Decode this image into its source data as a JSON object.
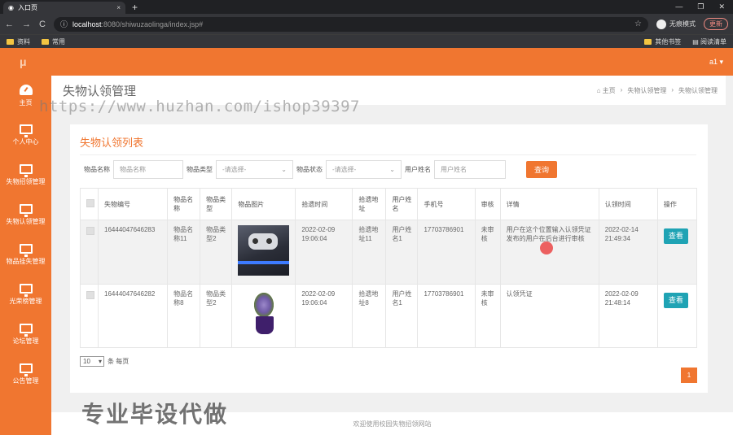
{
  "browser": {
    "tab_title": "入口页",
    "tab_close": "×",
    "new_tab": "+",
    "window_controls": [
      "—",
      "❐",
      "✕"
    ],
    "nav": [
      "←",
      "→",
      "C"
    ],
    "url_host": "localhost",
    "url_path": ":8080/shiwuzaolinga/index.jsp#",
    "star": "☆",
    "incognito": "无痕模式",
    "update_label": "更新",
    "bookmarks": [
      "资料",
      "常用"
    ],
    "bookmarks_right": [
      "其他书签",
      "阅读清单"
    ]
  },
  "header": {
    "logo": "μ",
    "user": "a1 ▾"
  },
  "sidebar": {
    "items": [
      {
        "label": "主页",
        "icon": "gauge-icon"
      },
      {
        "label": "个人中心",
        "icon": "monitor-icon"
      },
      {
        "label": "失物招领管理",
        "icon": "monitor-icon"
      },
      {
        "label": "失物认领管理",
        "icon": "monitor-icon"
      },
      {
        "label": "物品挂失管理",
        "icon": "monitor-icon"
      },
      {
        "label": "光荣榜管理",
        "icon": "monitor-icon"
      },
      {
        "label": "论坛管理",
        "icon": "monitor-icon"
      },
      {
        "label": "公告管理",
        "icon": "monitor-icon"
      }
    ]
  },
  "page": {
    "title": "失物认领管理",
    "breadcrumb": [
      "⌂ 主页",
      "›",
      "失物认领管理",
      "›",
      "失物认领管理"
    ]
  },
  "watermark": {
    "url": "https://www.huzhan.com/ishop39397",
    "slogan": "专业毕设代做"
  },
  "card": {
    "title": "失物认领列表",
    "filter": {
      "name_label": "物品名称",
      "name_placeholder": "物品名称",
      "type_label": "物品类型",
      "type_value": "-请选择-",
      "status_label": "物品状态",
      "status_value": "-请选择-",
      "user_label": "用户姓名",
      "user_placeholder": "用户姓名",
      "query_button": "查询"
    },
    "columns": [
      "失物编号",
      "物品名称",
      "物品类型",
      "物品图片",
      "拾遗时间",
      "拾遗地址",
      "用户姓名",
      "手机号",
      "审核",
      "详情",
      "认领时间",
      "操作"
    ],
    "rows": [
      {
        "id": "16444047646283",
        "name": "物品名称11",
        "type": "物品类型2",
        "time": "2022-02-09 19:06:04",
        "address": "拾遗地址11",
        "user": "用户姓名1",
        "phone": "17703786901",
        "review": "未审核",
        "detail": "用户在这个位置输入认领凭证发布的用户在后台进行审核",
        "claim_time": "2022-02-14 21:49:34",
        "action": "查看",
        "image": "console-photo"
      },
      {
        "id": "16444047646282",
        "name": "物品名称8",
        "type": "物品类型2",
        "time": "2022-02-09 19:06:04",
        "address": "拾遗地址8",
        "user": "用户姓名1",
        "phone": "17703786901",
        "review": "未审核",
        "detail": "认领凭证",
        "claim_time": "2022-02-09 21:48:14",
        "action": "查看",
        "image": "lavender-photo"
      }
    ],
    "page_size": "10",
    "page_size_suffix": "条 每页",
    "current_page": "1"
  },
  "footer": "欢迎使用校园失物招领网站"
}
